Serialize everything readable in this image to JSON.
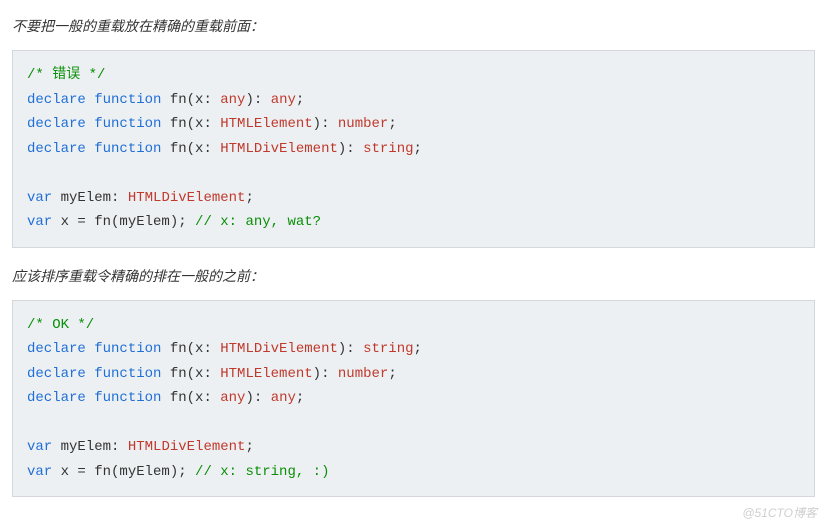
{
  "text": {
    "instruction1": "不要把一般的重载放在精确的重载前面：",
    "instruction2": "应该排序重载令精确的排在一般的之前："
  },
  "watermark": "@51CTO博客",
  "code1": {
    "comment": "/* 错误 */",
    "lines": [
      {
        "declare": "declare",
        "function": "function",
        "name": " fn(x: ",
        "param_type": "any",
        "post_param": "): ",
        "ret_type": "any",
        "end": ";"
      },
      {
        "declare": "declare",
        "function": "function",
        "name": " fn(x: ",
        "param_type": "HTMLElement",
        "post_param": "): ",
        "ret_type": "number",
        "end": ";"
      },
      {
        "declare": "declare",
        "function": "function",
        "name": " fn(x: ",
        "param_type": "HTMLDivElement",
        "post_param": "): ",
        "ret_type": "string",
        "end": ";"
      }
    ],
    "var1": {
      "var": "var",
      "rest": " myElem: ",
      "type": "HTMLDivElement",
      "end": ";"
    },
    "var2": {
      "var": "var",
      "rest": " x = fn(myElem); ",
      "comment": "// x: any, wat?"
    }
  },
  "code2": {
    "comment": "/* OK */",
    "lines": [
      {
        "declare": "declare",
        "function": "function",
        "name": " fn(x: ",
        "param_type": "HTMLDivElement",
        "post_param": "): ",
        "ret_type": "string",
        "end": ";"
      },
      {
        "declare": "declare",
        "function": "function",
        "name": " fn(x: ",
        "param_type": "HTMLElement",
        "post_param": "): ",
        "ret_type": "number",
        "end": ";"
      },
      {
        "declare": "declare",
        "function": "function",
        "name": " fn(x: ",
        "param_type": "any",
        "post_param": "): ",
        "ret_type": "any",
        "end": ";"
      }
    ],
    "var1": {
      "var": "var",
      "rest": " myElem: ",
      "type": "HTMLDivElement",
      "end": ";"
    },
    "var2": {
      "var": "var",
      "rest": " x = fn(myElem); ",
      "comment": "// x: string, :)"
    }
  }
}
